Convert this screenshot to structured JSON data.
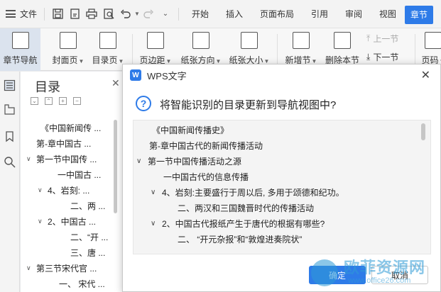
{
  "menubar": {
    "file_label": "文件",
    "tabs": [
      "开始",
      "插入",
      "页面布局",
      "引用",
      "审阅",
      "视图",
      "章节"
    ],
    "active_tab": "章节"
  },
  "ribbon": {
    "chapter_nav": "章节导航",
    "cover_page": "封面页",
    "toc_page": "目录页",
    "margins": "页边距",
    "orientation": "纸张方向",
    "paper_size": "纸张大小",
    "new_section": "新增节",
    "delete_section": "删除本节",
    "prev_section": "上一节",
    "next_section": "下一节",
    "page_number": "页码"
  },
  "nav": {
    "title": "目录",
    "close": "✕",
    "items": [
      {
        "label": "《中国新闻传 ...",
        "level": 0,
        "toggle": ""
      },
      {
        "label": "第-章中国古 ...",
        "level": 0,
        "toggle": ""
      },
      {
        "label": "第一节中国传 ...",
        "level": 0,
        "toggle": "∨"
      },
      {
        "label": "一中国古 ...",
        "level": 1,
        "toggle": ""
      },
      {
        "label": "4、岩刻: ...",
        "level": 1,
        "toggle": "∨"
      },
      {
        "label": "二、两 ...",
        "level": 2,
        "toggle": ""
      },
      {
        "label": "2、中国古 ...",
        "level": 1,
        "toggle": "∨"
      },
      {
        "label": "二、“开 ...",
        "level": 2,
        "toggle": ""
      },
      {
        "label": "三、唐 ...",
        "level": 2,
        "toggle": ""
      },
      {
        "label": "第三节宋代官 ...",
        "level": 0,
        "toggle": "∨"
      },
      {
        "label": "一、 宋代 ...",
        "level": 2,
        "toggle": ""
      }
    ]
  },
  "dialog": {
    "title": "WPS文字",
    "logo": "W",
    "close": "✕",
    "question_icon": "?",
    "question": "将智能识别的目录更新到导航视图中?",
    "tree": [
      {
        "label": "《中国新闻传播史》",
        "indent": 0,
        "toggle": ""
      },
      {
        "label": "第-章中国古代的新闻传播活动",
        "indent": 0,
        "toggle": ""
      },
      {
        "label": "第一节中国传播活动之源",
        "indent": 0,
        "toggle": "∨"
      },
      {
        "label": "一中国古代的信息传播",
        "indent": 1,
        "toggle": ""
      },
      {
        "label": "4、岩刻:主要盛行于周以后, 多用于颂德和纪功。",
        "indent": 1,
        "toggle": "∨"
      },
      {
        "label": "二、两汉和三国魏晋时代的传播活动",
        "indent": 2,
        "toggle": ""
      },
      {
        "label": "2、中国古代报纸产生于唐代的根据有哪些?",
        "indent": 1,
        "toggle": "∨"
      },
      {
        "label": "二、 “开元杂报”和“敦煌进奏院状”",
        "indent": 2,
        "toggle": ""
      }
    ],
    "ok_label": "确定",
    "cancel_label": "取消"
  },
  "watermark": {
    "text": "欧菲资源网",
    "url": "www.office26.com"
  },
  "colors": {
    "accent": "#2e7be8",
    "watermark": "#2e9ad6"
  }
}
